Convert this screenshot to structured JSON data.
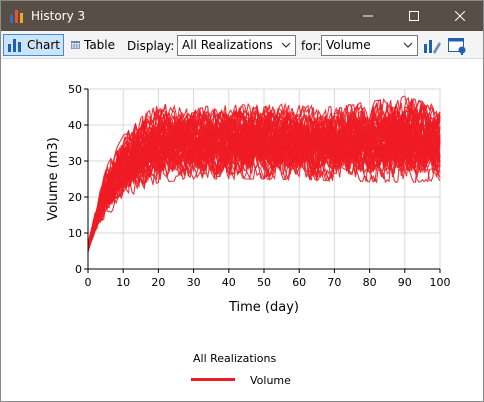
{
  "window": {
    "title": "History 3",
    "minimize_label": "minimize",
    "maximize_label": "maximize",
    "close_label": "close"
  },
  "toolbar": {
    "chart_label": "Chart",
    "table_label": "Table",
    "display_label": "Display:",
    "display_value": "All Realizations",
    "for_label": "for:",
    "for_value": "Volume"
  },
  "icons": {
    "app": "bar-chart-icon",
    "chart": "bar-chart-icon",
    "table": "table-grid-icon",
    "export": "export-chart-icon",
    "properties": "chart-properties-icon"
  },
  "colors": {
    "series": "#ee1c25",
    "titlebar": "#574f47",
    "selected_button": "#cce4f7"
  },
  "chart_data": {
    "type": "line",
    "xlabel": "Time (day)",
    "ylabel": "Volume (m3)",
    "xlim": [
      0,
      100
    ],
    "ylim": [
      0,
      50
    ],
    "x_ticks": [
      "0",
      "10",
      "20",
      "30",
      "40",
      "50",
      "60",
      "70",
      "80",
      "90",
      "100"
    ],
    "y_ticks": [
      "0",
      "10",
      "20",
      "30",
      "40",
      "50"
    ],
    "grid": true,
    "legend_title": "All Realizations",
    "legend_position": "bottom",
    "series": [
      {
        "name": "Volume",
        "color": "#ee1c25"
      }
    ],
    "envelope": {
      "x": [
        0,
        2,
        5,
        10,
        15,
        20,
        30,
        50,
        70,
        90,
        100
      ],
      "y_min": [
        4.5,
        10,
        14,
        19,
        22,
        24,
        25,
        25,
        24.5,
        24,
        24.5
      ],
      "y_max": [
        7,
        16,
        28,
        37,
        42,
        46,
        45,
        46,
        45,
        48,
        45
      ]
    }
  }
}
